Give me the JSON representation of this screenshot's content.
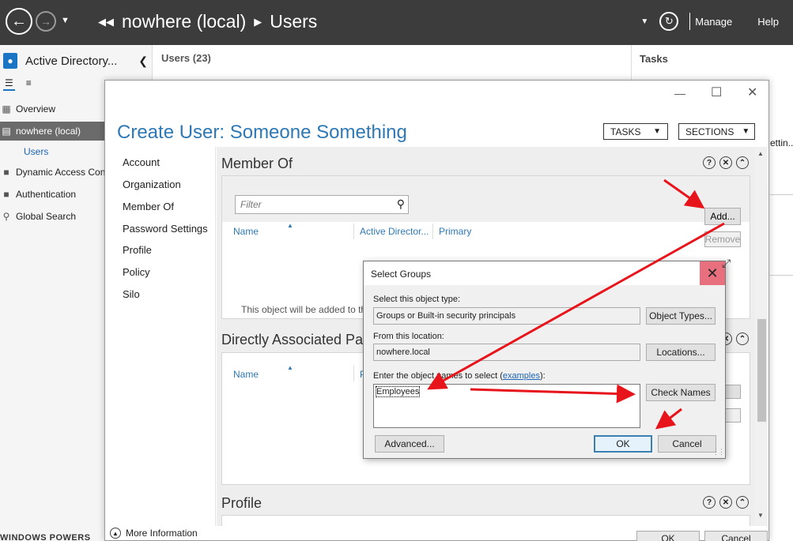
{
  "topbar": {
    "breadcrumb": [
      "nowhere (local)",
      "Users"
    ],
    "menus": [
      "Manage",
      "Help"
    ]
  },
  "leftnav": {
    "title": "Active Directory...",
    "items": [
      {
        "label": "Overview",
        "icon": "grid-icon"
      },
      {
        "label": "nowhere (local)",
        "icon": "server-icon",
        "selected": true
      },
      {
        "label": "Users",
        "sub": true
      },
      {
        "label": "Dynamic Access Cont",
        "icon": "folder-icon"
      },
      {
        "label": "Authentication",
        "icon": "folder-icon"
      },
      {
        "label": "Global Search",
        "icon": "search-icon"
      }
    ]
  },
  "mainlist": {
    "title": "Users",
    "count": "(23)"
  },
  "tasks": {
    "title": "Tasks",
    "fragment": "ettin..."
  },
  "create_user": {
    "title": "Create User: Someone Something",
    "tasks_dropdown": "TASKS",
    "sections_dropdown": "SECTIONS",
    "sidebar": [
      "Account",
      "Organization",
      "Member Of",
      "Password Settings",
      "Profile",
      "Policy",
      "Silo"
    ],
    "member_of": {
      "title": "Member Of",
      "filter_placeholder": "Filter",
      "columns": [
        "Name",
        "Active Director...",
        "Primary"
      ],
      "add_label": "Add...",
      "remove_label": "Remove",
      "hint": "This object will be added to th"
    },
    "password_section": {
      "title": "Directly Associated Pass",
      "columns": [
        "Name",
        "P"
      ]
    },
    "profile_section": {
      "title": "Profile"
    },
    "footer": {
      "more_info": "More Information",
      "ok": "OK",
      "cancel": "Cancel"
    }
  },
  "select_groups": {
    "title": "Select Groups",
    "object_type_label": "Select this object type:",
    "object_type_value": "Groups or Built-in security principals",
    "object_types_btn": "Object Types...",
    "location_label": "From this location:",
    "location_value": "nowhere.local",
    "locations_btn": "Locations...",
    "enter_label": "Enter the object names to select (",
    "examples_link": "examples",
    "enter_label_end": "):",
    "entered_value": "Employees",
    "check_names_btn": "Check Names",
    "advanced_btn": "Advanced...",
    "ok_btn": "OK",
    "cancel_btn": "Cancel"
  },
  "bottom_hint": "WINDOWS POWERS",
  "colors": {
    "topbar": "#3c3c3c",
    "accent": "#2e79b5",
    "selected_nav": "#6b6b6b",
    "close_hover": "#e8707e",
    "arrow": "#e8141b"
  }
}
